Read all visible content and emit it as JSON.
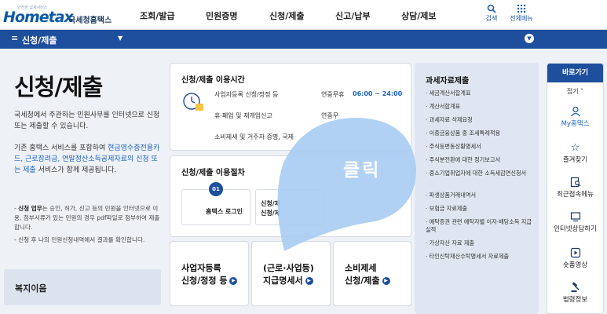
{
  "header": {
    "logo_tagline": "안전한 납세서비스",
    "logo_word": "Hometax",
    "logo_org": "국세청홈택스",
    "nav": [
      "조회/발급",
      "민원증명",
      "신청/제출",
      "신고/납부",
      "상담/제보"
    ],
    "search_label": "검색",
    "all_menu_label": "전체메뉴"
  },
  "menubar": {
    "title": "신청/제출"
  },
  "intro": {
    "title": "신청/제출",
    "desc1": "국세청에서 주관하는 민원사무를 인터넷으로 신청 또는 제출할 수 있습니다.",
    "desc2_a": "기존 홈택스 서비스를 포함하여 ",
    "desc2_b": "현금영수증전용카드, 근로장려금, 연말정산소득공제자료의 신청 또는 제출",
    "desc2_c": " 서비스가 함께 제공됩니다.",
    "note1_label": "신청 업무",
    "note1": "는 승인, 허가, 신고 등의 민원을 인터넷으로 이용, 첨부서류가 있는 민원의 경우 pdf파일로 첨부하여 제출합니다.",
    "note2": "신청 후 나의 민원신청내역에서 결과를 확인합니다.",
    "welfare": "복지이음"
  },
  "hours": {
    "title": "신청/제출 이용시간",
    "rows": [
      {
        "label": "사업자등록 신청/정정 등",
        "prefix": "연중무휴",
        "time": "06:00 ~ 24:00"
      },
      {
        "label": "휴·폐업 및 재개업신고",
        "prefix": "연중무",
        "time": ""
      },
      {
        "label": "소비제세 및 거주자 증명, 국제",
        "prefix": "",
        "time": ""
      }
    ]
  },
  "procedure": {
    "title": "신청/제출 이용절차",
    "steps": [
      {
        "num": "01",
        "label": "홈택스 로그인"
      },
      {
        "num": "",
        "label": "신청/제\n신청/제"
      }
    ]
  },
  "tiles": [
    {
      "line1": "사업자등록",
      "line2": "신청/정정 등"
    },
    {
      "line1": "(근로·사업등)",
      "line2": "지급명세서"
    },
    {
      "line1": "소비제세",
      "line2": "신청/제출"
    }
  ],
  "info": {
    "title": "과세자료제출",
    "items": [
      "세금계산서합계표",
      "계산서합계표",
      "과세자료 삭제요청",
      "이중금융상품 중 조세특례적용",
      "주식등변동상황명세서",
      "주식분전환에 대한 정기보고서",
      "중소기업취업자에 대한 소득세감면신청서",
      "파생상품거래내역서",
      "보험금 자료제출",
      "예탁증권 관련 예탁자별 이자·배당소득 지급 실적",
      "가상자산 자료 제출",
      "타인신탁재산수탁명세서 자료제출"
    ]
  },
  "quick": {
    "title": "바로가기",
    "fold": "접기",
    "items": [
      "My홈택스",
      "즐겨찾기",
      "최근접속메뉴",
      "인터넷상담하기",
      "숏폼영상",
      "법령정보"
    ]
  },
  "overlay": {
    "label": "클릭"
  },
  "colors": {
    "primary": "#1e4f9c",
    "bubble": "#a9cdf2",
    "page_bg": "#eef1f6"
  }
}
